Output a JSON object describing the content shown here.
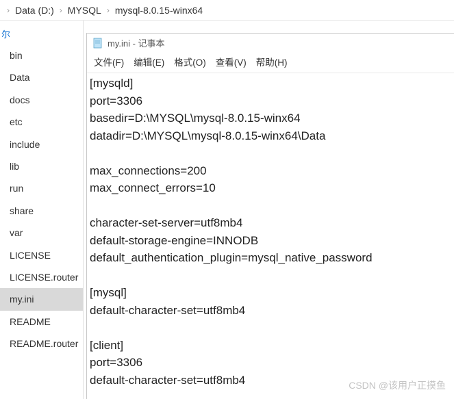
{
  "breadcrumb": {
    "item1": "Data (D:)",
    "item2": "MYSQL",
    "item3": "mysql-8.0.15-winx64"
  },
  "sidebar": {
    "header": "尔",
    "items": [
      {
        "label": "bin"
      },
      {
        "label": "Data"
      },
      {
        "label": "docs"
      },
      {
        "label": "etc"
      },
      {
        "label": "include"
      },
      {
        "label": "lib"
      },
      {
        "label": "run"
      },
      {
        "label": "share"
      },
      {
        "label": "var"
      },
      {
        "label": "LICENSE"
      },
      {
        "label": "LICENSE.router"
      },
      {
        "label": "my.ini"
      },
      {
        "label": "README"
      },
      {
        "label": "README.router"
      }
    ],
    "selected": "my.ini"
  },
  "notepad": {
    "title": "my.ini - 记事本",
    "menu": {
      "file": "文件(F)",
      "edit": "编辑(E)",
      "format": "格式(O)",
      "view": "查看(V)",
      "help": "帮助(H)"
    },
    "content": "[mysqld]\nport=3306\nbasedir=D:\\MYSQL\\mysql-8.0.15-winx64\ndatadir=D:\\MYSQL\\mysql-8.0.15-winx64\\Data\n\nmax_connections=200\nmax_connect_errors=10\n\ncharacter-set-server=utf8mb4\ndefault-storage-engine=INNODB\ndefault_authentication_plugin=mysql_native_password\n\n[mysql]\ndefault-character-set=utf8mb4\n\n[client]\nport=3306\ndefault-character-set=utf8mb4"
  },
  "watermark": "CSDN @该用户正摸鱼"
}
